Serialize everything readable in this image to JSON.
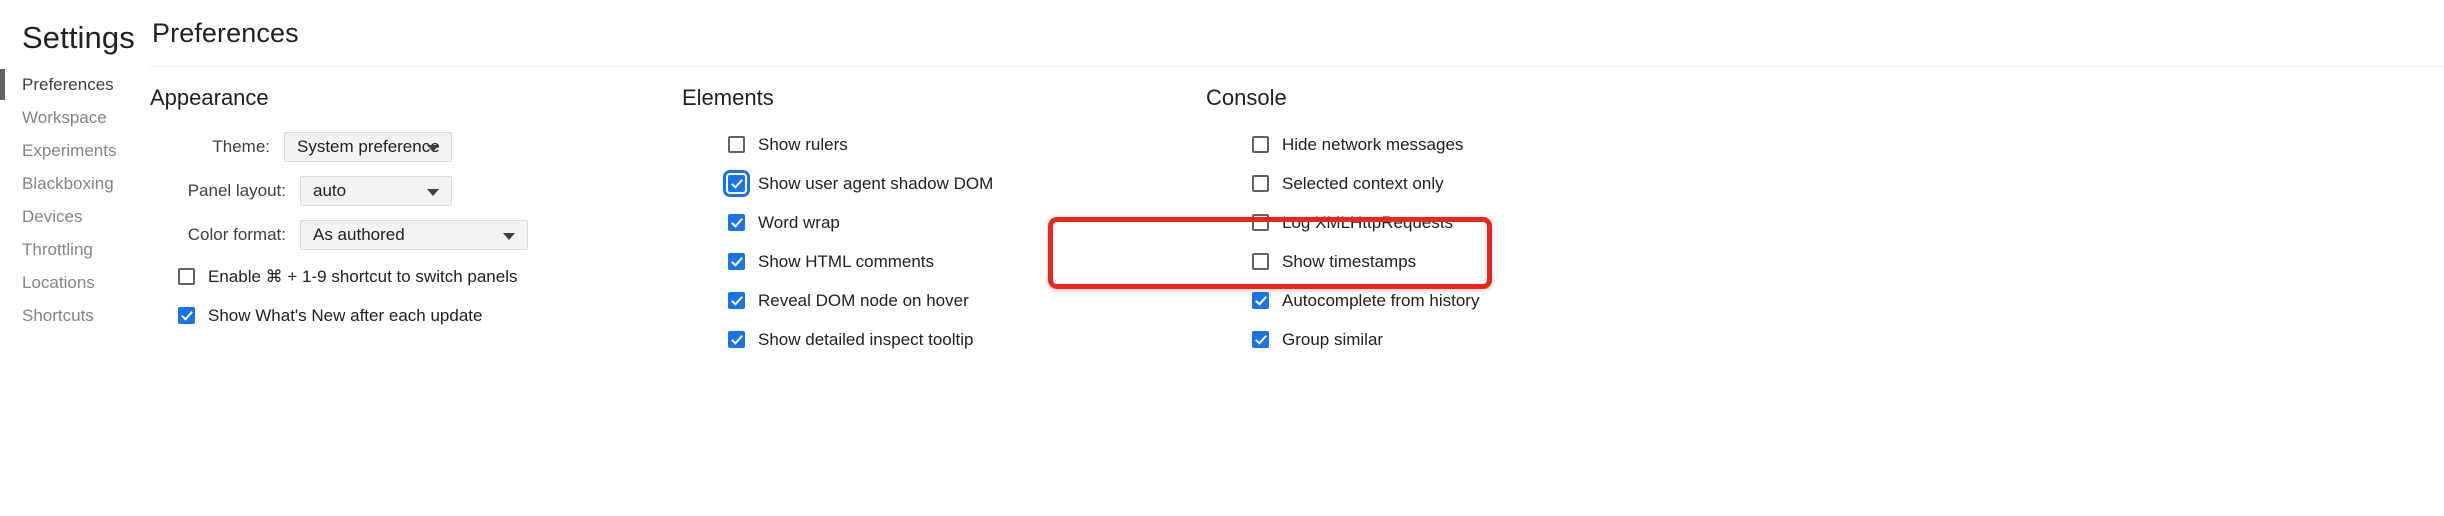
{
  "sidebar": {
    "title": "Settings",
    "items": [
      {
        "label": "Preferences",
        "selected": true
      },
      {
        "label": "Workspace",
        "selected": false
      },
      {
        "label": "Experiments",
        "selected": false
      },
      {
        "label": "Blackboxing",
        "selected": false
      },
      {
        "label": "Devices",
        "selected": false
      },
      {
        "label": "Throttling",
        "selected": false
      },
      {
        "label": "Locations",
        "selected": false
      },
      {
        "label": "Shortcuts",
        "selected": false
      }
    ]
  },
  "header": {
    "title": "Preferences"
  },
  "appearance": {
    "heading": "Appearance",
    "fields": [
      {
        "label": "Theme:",
        "value": "System preference"
      },
      {
        "label": "Panel layout:",
        "value": "auto"
      },
      {
        "label": "Color format:",
        "value": "As authored"
      }
    ],
    "checkboxes": [
      {
        "label": "Enable ⌘ + 1-9 shortcut to switch panels",
        "checked": false
      },
      {
        "label": "Show What's New after each update",
        "checked": true
      }
    ]
  },
  "elements": {
    "heading": "Elements",
    "checkboxes": [
      {
        "label": "Show rulers",
        "checked": false,
        "focused": false,
        "highlighted": false
      },
      {
        "label": "Show user agent shadow DOM",
        "checked": true,
        "focused": true,
        "highlighted": true
      },
      {
        "label": "Word wrap",
        "checked": true,
        "focused": false,
        "highlighted": false
      },
      {
        "label": "Show HTML comments",
        "checked": true,
        "focused": false,
        "highlighted": false
      },
      {
        "label": "Reveal DOM node on hover",
        "checked": true,
        "focused": false,
        "highlighted": false
      },
      {
        "label": "Show detailed inspect tooltip",
        "checked": true,
        "focused": false,
        "highlighted": false
      }
    ]
  },
  "console": {
    "heading": "Console",
    "checkboxes": [
      {
        "label": "Hide network messages",
        "checked": false
      },
      {
        "label": "Selected context only",
        "checked": false
      },
      {
        "label": "Log XMLHttpRequests",
        "checked": false
      },
      {
        "label": "Show timestamps",
        "checked": false
      },
      {
        "label": "Autocomplete from history",
        "checked": true
      },
      {
        "label": "Group similar",
        "checked": true
      }
    ]
  },
  "annotation": {
    "type": "highlight-rectangle",
    "color": "#f02417",
    "target": "Show user agent shadow DOM"
  },
  "colors": {
    "accent": "#1a73e8",
    "text_primary": "#202124",
    "text_muted": "#80868b",
    "highlight": "#f02417"
  }
}
